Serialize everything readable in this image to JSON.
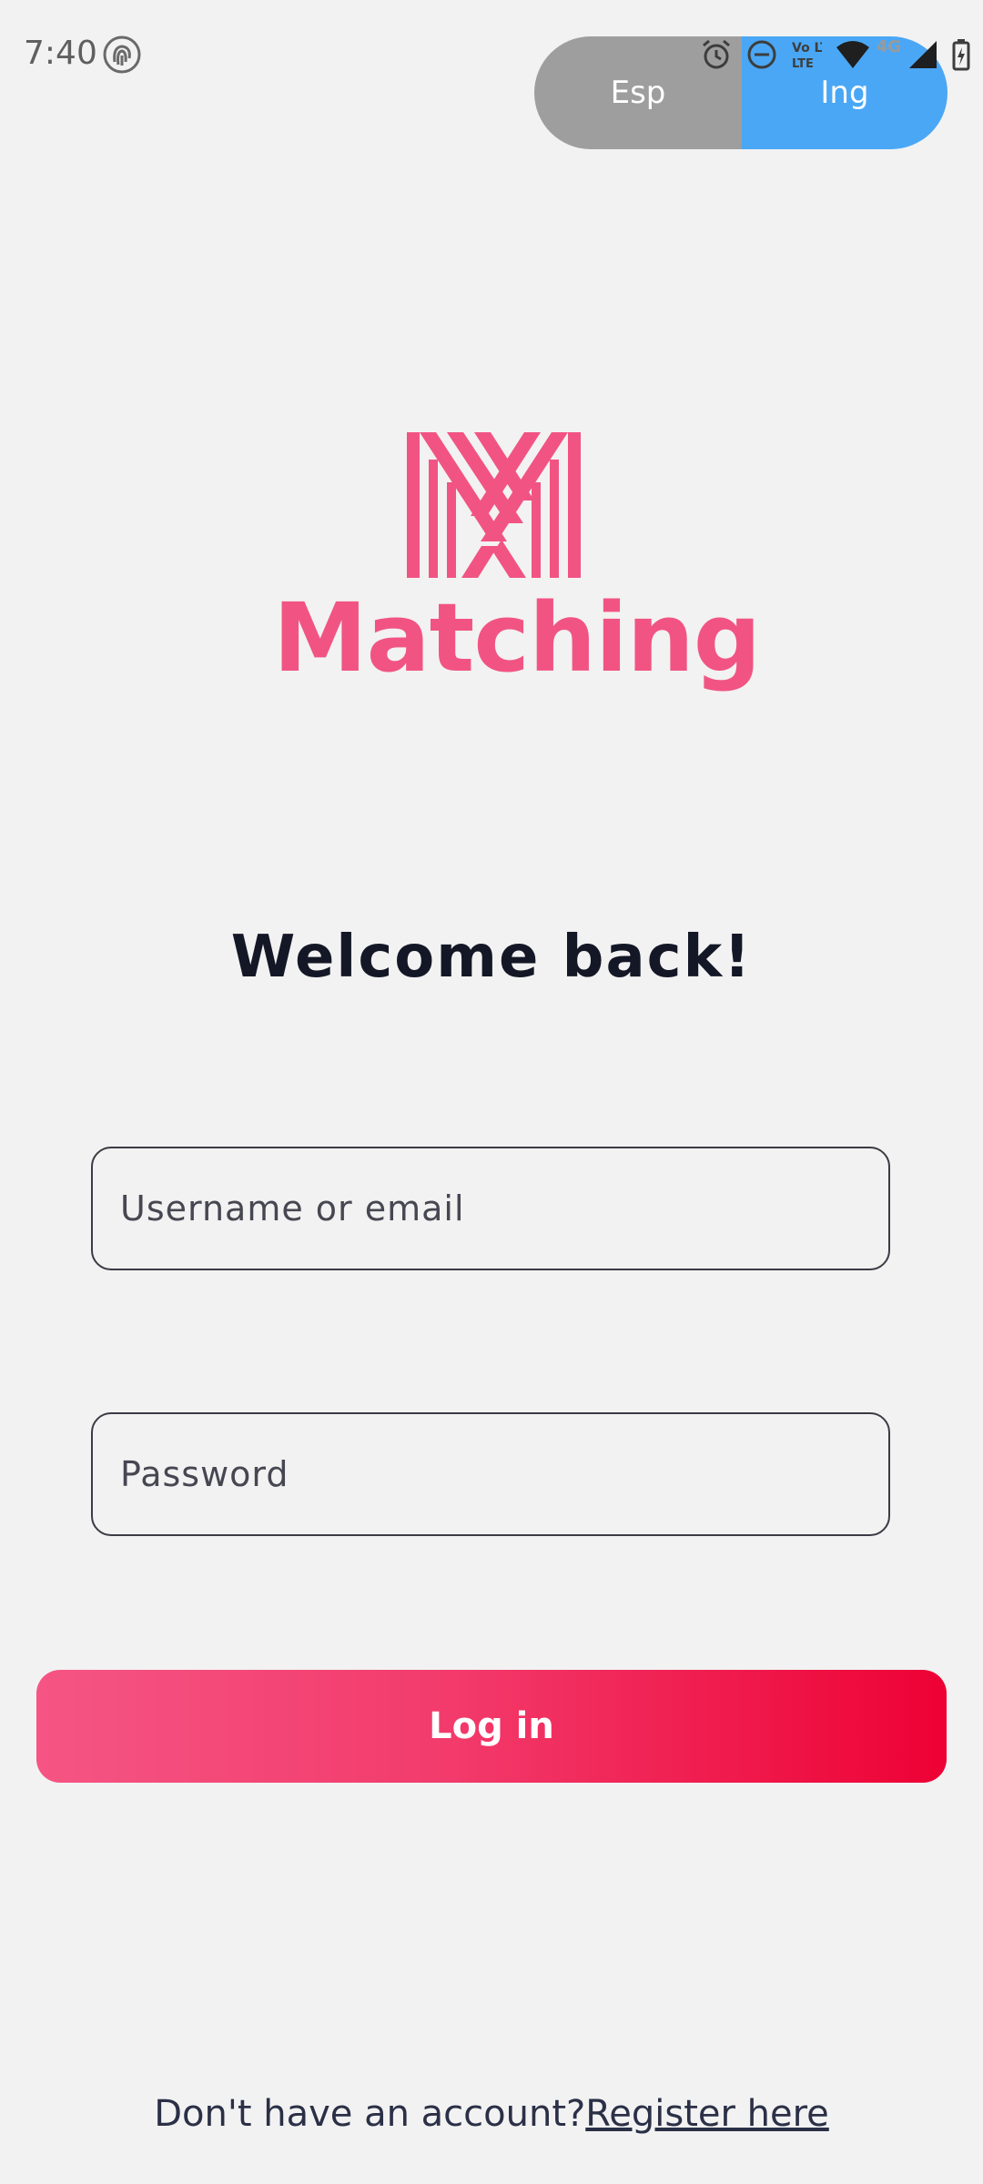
{
  "status_bar": {
    "time": "7:40",
    "network_label": "4G",
    "volte_label": "Vo LTE",
    "icons": [
      "fingerprint-icon",
      "alarm-icon",
      "do-not-disturb-icon",
      "volte-icon",
      "wifi-icon",
      "signal-icon",
      "battery-charging-icon"
    ]
  },
  "language_toggle": {
    "options": [
      "Esp",
      "Ing"
    ],
    "selected": "Ing",
    "colors": {
      "inactive": "#9e9e9e",
      "active": "#4aa7f5"
    }
  },
  "logo": {
    "text": "Matching",
    "color": "#f15483"
  },
  "welcome": "Welcome back!",
  "form": {
    "username": {
      "placeholder": "Username or email",
      "value": ""
    },
    "password": {
      "placeholder": "Password",
      "value": ""
    }
  },
  "login_button": {
    "label": "Log in",
    "gradient": [
      "#f55584",
      "#ee0134"
    ]
  },
  "register": {
    "prompt": "Don't have an account?",
    "link": "Register here"
  }
}
